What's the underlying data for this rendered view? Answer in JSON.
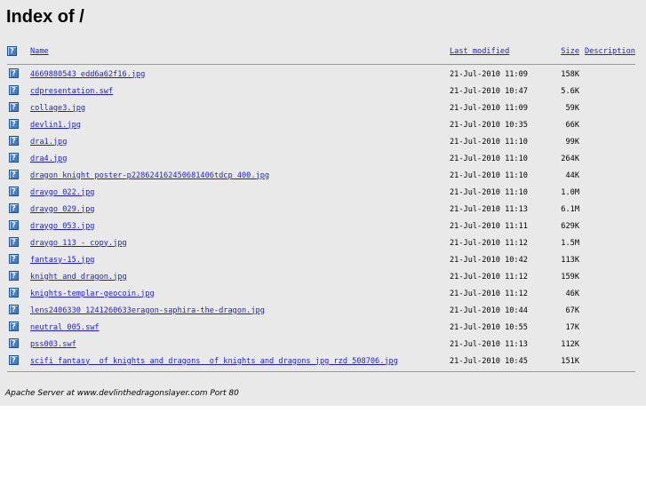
{
  "page": {
    "title": "Index of /",
    "footer": "Apache Server at www.devlinthedragonslayer.com Port 80"
  },
  "columns": {
    "name": "Name",
    "last_modified": "Last modified",
    "size": "Size",
    "description": "Description"
  },
  "files": [
    {
      "name": "4669880543_edd6a62f16.jpg",
      "modified": "21-Jul-2010 11:09",
      "size": "158K",
      "icon": "unknown-file-icon"
    },
    {
      "name": "cdpresentation.swf",
      "modified": "21-Jul-2010 10:47",
      "size": "5.6K",
      "icon": "unknown-file-icon"
    },
    {
      "name": "collage3.jpg",
      "modified": "21-Jul-2010 11:09",
      "size": "59K",
      "icon": "unknown-file-icon"
    },
    {
      "name": "devlin1.jpg",
      "modified": "21-Jul-2010 10:35",
      "size": "66K",
      "icon": "unknown-file-icon"
    },
    {
      "name": "dra1.jpg",
      "modified": "21-Jul-2010 11:10",
      "size": "99K",
      "icon": "unknown-file-icon"
    },
    {
      "name": "dra4.jpg",
      "modified": "21-Jul-2010 11:10",
      "size": "264K",
      "icon": "unknown-file-icon"
    },
    {
      "name": "dragon_knight_poster-p228624162450681406tdcp_400.jpg",
      "modified": "21-Jul-2010 11:10",
      "size": "44K",
      "icon": "unknown-file-icon"
    },
    {
      "name": "draygo 022.jpg",
      "modified": "21-Jul-2010 11:10",
      "size": "1.0M",
      "icon": "unknown-file-icon"
    },
    {
      "name": "draygo 029.jpg",
      "modified": "21-Jul-2010 11:13",
      "size": "6.1M",
      "icon": "unknown-file-icon"
    },
    {
      "name": "draygo 053.jpg",
      "modified": "21-Jul-2010 11:11",
      "size": "629K",
      "icon": "unknown-file-icon"
    },
    {
      "name": "draygo 113 - copy.jpg",
      "modified": "21-Jul-2010 11:12",
      "size": "1.5M",
      "icon": "unknown-file-icon"
    },
    {
      "name": "fantasy-15.jpg",
      "modified": "21-Jul-2010 10:42",
      "size": "113K",
      "icon": "unknown-file-icon"
    },
    {
      "name": "knight_and_dragon.jpg",
      "modified": "21-Jul-2010 11:12",
      "size": "159K",
      "icon": "unknown-file-icon"
    },
    {
      "name": "knights-templar-geocoin.jpg",
      "modified": "21-Jul-2010 11:12",
      "size": "46K",
      "icon": "unknown-file-icon"
    },
    {
      "name": "lens2406330_1241260633eragon-saphira-the-dragon.jpg",
      "modified": "21-Jul-2010 10:44",
      "size": "67K",
      "icon": "unknown-file-icon"
    },
    {
      "name": "neutral 005.swf",
      "modified": "21-Jul-2010 10:55",
      "size": "17K",
      "icon": "unknown-file-icon"
    },
    {
      "name": "pss003.swf",
      "modified": "21-Jul-2010 11:13",
      "size": "112K",
      "icon": "unknown-file-icon"
    },
    {
      "name": "scifi_fantasy__of_knights_and_dragons__of_knights_and_dragons_jpg_rzd_508706.jpg",
      "modified": "21-Jul-2010 10:45",
      "size": "151K",
      "icon": "unknown-file-icon"
    }
  ],
  "colors": {
    "background": "#e9e9e9",
    "link": "#1d1dd9",
    "icon": "#4a7bc0"
  }
}
